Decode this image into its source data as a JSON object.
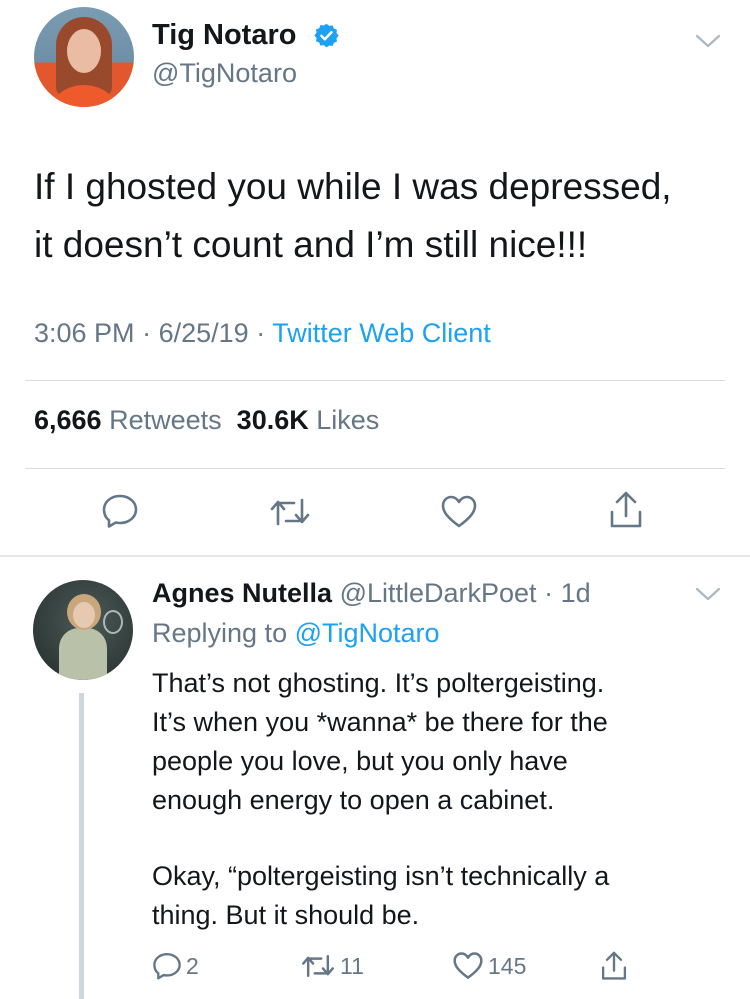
{
  "main_tweet": {
    "author_name": "Tig Notaro",
    "author_handle": "@TigNotaro",
    "verified": true,
    "text_lines": [
      "If I ghosted you while I was depressed,",
      "it doesn’t count and I’m still nice!!!"
    ],
    "time": "3:06 PM",
    "date": "6/25/19",
    "client": "Twitter Web Client",
    "retweets_count": "6,666",
    "retweets_label": "Retweets",
    "likes_count": "30.6K",
    "likes_label": "Likes",
    "actions": [
      "reply-icon",
      "retweet-icon",
      "like-icon",
      "share-icon"
    ]
  },
  "reply": {
    "author_name": "Agnes Nutella",
    "author_handle": "@LittleDarkPoet",
    "age": "1d",
    "replying_to_label": "Replying to",
    "replying_to_handle": "@TigNotaro",
    "text_lines": [
      "That’s not ghosting. It’s poltergeisting.",
      "It’s when you *wanna* be there for the",
      "people you love, but you only have",
      "enough energy to open a cabinet."
    ],
    "text_lines_2": [
      "Okay, “poltergeisting isn’t technically a",
      "thing. But it should be."
    ],
    "reply_count": "2",
    "retweet_count": "11",
    "like_count": "145"
  },
  "colors": {
    "link_blue": "#1da1f2",
    "secondary_gray": "#657786",
    "text_dark": "#14171a",
    "divider": "#d8dde1"
  }
}
